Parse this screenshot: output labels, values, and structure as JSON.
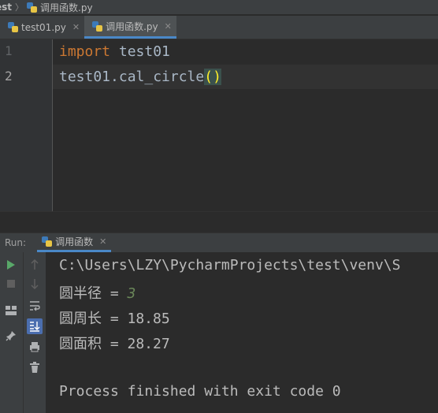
{
  "breadcrumb": {
    "project": "est",
    "file": "调用函数.py"
  },
  "tabs": [
    {
      "label": "test01.py",
      "active": false
    },
    {
      "label": "调用函数.py",
      "active": true
    }
  ],
  "editor": {
    "line_numbers": [
      "1",
      "2"
    ],
    "line1": {
      "keyword": "import",
      "rest": " test01"
    },
    "line2": {
      "call": "test01.cal_circle",
      "parens": "()"
    }
  },
  "run_panel": {
    "label": "Run:",
    "tab_label": "调用函数",
    "console": {
      "path": "C:\\Users\\LZY\\PycharmProjects\\test\\venv\\S",
      "input_prompt": "圆半径 = ",
      "input_value": "3",
      "line_circumference": "圆周长 = 18.85",
      "line_area": "圆面积 = 28.27",
      "exit_message": "Process finished with exit code 0"
    }
  },
  "colors": {
    "keyword": "#cc7832",
    "paren_highlight": "#ffef28",
    "input_value": "#6a8759",
    "accent": "#4a88c7"
  },
  "icons": [
    "python-file-icon",
    "run-icon",
    "stop-icon",
    "layout-icon",
    "pin-icon",
    "up-arrow-icon",
    "down-arrow-icon",
    "soft-wrap-icon",
    "scroll-to-end-icon",
    "print-icon",
    "trash-icon"
  ]
}
